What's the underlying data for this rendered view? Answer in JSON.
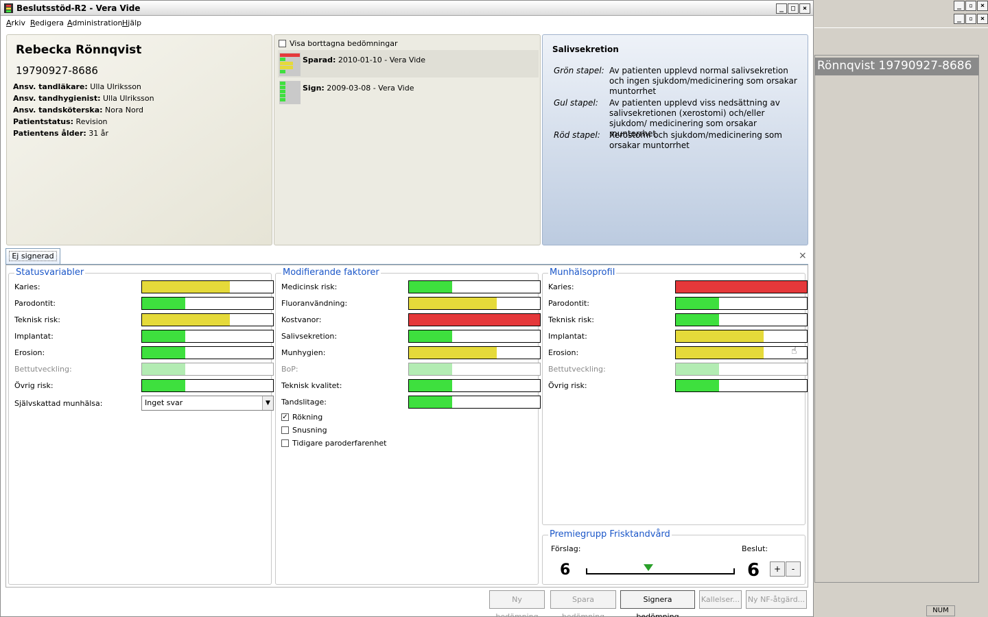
{
  "window": {
    "title": "Beslutsstöd-R2 - Vera Vide",
    "min": "_",
    "max": "□",
    "close": "×"
  },
  "menu": [
    "Arkiv",
    "Redigera",
    "Administration",
    "Hjälp"
  ],
  "patient": {
    "name": "Rebecka Rönnqvist",
    "pnr": "19790927-8686",
    "rows": [
      {
        "label": "Ansv. tandläkare:",
        "value": "Ulla Ulriksson"
      },
      {
        "label": "Ansv. tandhygienist:",
        "value": "Ulla Ulriksson"
      },
      {
        "label": "Ansv. tandsköterska:",
        "value": "Nora Nord"
      },
      {
        "label": "Patientstatus:",
        "value": "Revision"
      },
      {
        "label": "Patientens ålder:",
        "value": "31 år"
      }
    ]
  },
  "history": {
    "show_deleted": "Visa borttagna bedömningar",
    "items": [
      {
        "status": "Sparad:",
        "text": "2010-01-10 - Vera Vide"
      },
      {
        "status": "Sign:",
        "text": "2009-03-08 - Vera Vide"
      }
    ]
  },
  "description": {
    "title": "Salivsekretion",
    "rows": [
      {
        "label": "Grön stapel:",
        "text": "Av patienten upplevd normal salivsekretion och ingen sjukdom/medicinering som orsakar muntorrhet"
      },
      {
        "label": "Gul stapel:",
        "text": "Av patienten upplevd viss nedsättning av salivsekretionen (xerostomi) och/eller sjukdom/ medicinering som orsakar muntorrhet"
      },
      {
        "label": "Röd stapel:",
        "text": "Xerostomi och sjukdom/medicinering som orsakar muntorrhet"
      }
    ]
  },
  "tab": {
    "label": "Ej signerad",
    "close": "×"
  },
  "colors": {
    "green": "#3ee03e",
    "yellow": "#e5da3a",
    "red": "#e5383a",
    "lightgreen": "#b3ecb3"
  },
  "status_variables": {
    "title": "Statusvariabler",
    "rows": [
      {
        "label": "Karies:",
        "level": "yellow",
        "fill": 0.67
      },
      {
        "label": "Parodontit:",
        "level": "green",
        "fill": 0.33
      },
      {
        "label": "Teknisk risk:",
        "level": "yellow",
        "fill": 0.67
      },
      {
        "label": "Implantat:",
        "level": "green",
        "fill": 0.33
      },
      {
        "label": "Erosion:",
        "level": "green",
        "fill": 0.33
      },
      {
        "label": "Bettutveckling:",
        "level": "lightgreen",
        "fill": 0.33,
        "disabled": true
      },
      {
        "label": "Övrig risk:",
        "level": "green",
        "fill": 0.33
      }
    ],
    "self_rated_label": "Självskattad munhälsa:",
    "self_rated_value": "Inget svar"
  },
  "modifying_factors": {
    "title": "Modifierande faktorer",
    "rows": [
      {
        "label": "Medicinsk risk:",
        "level": "green",
        "fill": 0.33
      },
      {
        "label": "Fluoranvändning:",
        "level": "yellow",
        "fill": 0.67
      },
      {
        "label": "Kostvanor:",
        "level": "red",
        "fill": 1.0
      },
      {
        "label": "Salivsekretion:",
        "level": "green",
        "fill": 0.33
      },
      {
        "label": "Munhygien:",
        "level": "yellow",
        "fill": 0.67
      },
      {
        "label": "BoP:",
        "level": "lightgreen",
        "fill": 0.33,
        "disabled": true
      },
      {
        "label": "Teknisk kvalitet:",
        "level": "green",
        "fill": 0.33
      },
      {
        "label": "Tandslitage:",
        "level": "green",
        "fill": 0.33
      }
    ],
    "checks": [
      {
        "label": "Rökning",
        "checked": true
      },
      {
        "label": "Snusning",
        "checked": false
      },
      {
        "label": "Tidigare paroderfarenhet",
        "checked": false
      }
    ]
  },
  "oral_profile": {
    "title": "Munhälsoprofil",
    "rows": [
      {
        "label": "Karies:",
        "level": "red",
        "fill": 1.0
      },
      {
        "label": "Parodontit:",
        "level": "green",
        "fill": 0.33
      },
      {
        "label": "Teknisk risk:",
        "level": "green",
        "fill": 0.33
      },
      {
        "label": "Implantat:",
        "level": "yellow",
        "fill": 0.67
      },
      {
        "label": "Erosion:",
        "level": "yellow",
        "fill": 0.67
      },
      {
        "label": "Bettutveckling:",
        "level": "lightgreen",
        "fill": 0.33,
        "disabled": true
      },
      {
        "label": "Övrig risk:",
        "level": "green",
        "fill": 0.33
      }
    ]
  },
  "premium": {
    "title": "Premiegrupp Frisktandvård",
    "proposal_label": "Förslag:",
    "proposal": "6",
    "decision_label": "Beslut:",
    "decision": "6",
    "plus": "+",
    "minus": "-"
  },
  "buttons": [
    {
      "label": "Ny bedömning",
      "enabled": false
    },
    {
      "label": "Spara bedömning",
      "enabled": false
    },
    {
      "label": "Signera bedömning",
      "enabled": true
    },
    {
      "label": "Kallelser...",
      "enabled": false
    },
    {
      "label": "Ny NF-åtgärd...",
      "enabled": false
    }
  ],
  "background_window": {
    "title": "Rönnqvist   19790927-8686",
    "status": "NUM"
  }
}
